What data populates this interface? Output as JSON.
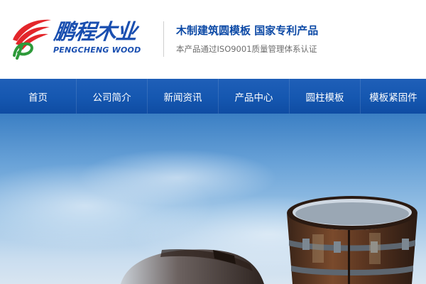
{
  "header": {
    "logo_cn": "鹏程木业",
    "logo_en": "PENGCHENG WOOD",
    "slogan": "木制建筑圆模板 国家专利产品",
    "subslogan": "本产品通过ISO9001质量管理体系认证",
    "brand_color": "#1a4fb0",
    "accent_red": "#e3262b",
    "accent_green": "#2e9a3a"
  },
  "nav": {
    "background": "#1557b0",
    "items": [
      {
        "label": "首页"
      },
      {
        "label": "公司简介"
      },
      {
        "label": "新闻资讯"
      },
      {
        "label": "产品中心"
      },
      {
        "label": "圆柱模板"
      },
      {
        "label": "模板紧固件"
      }
    ]
  },
  "banner": {
    "sky_color": "#6aa3d8"
  }
}
